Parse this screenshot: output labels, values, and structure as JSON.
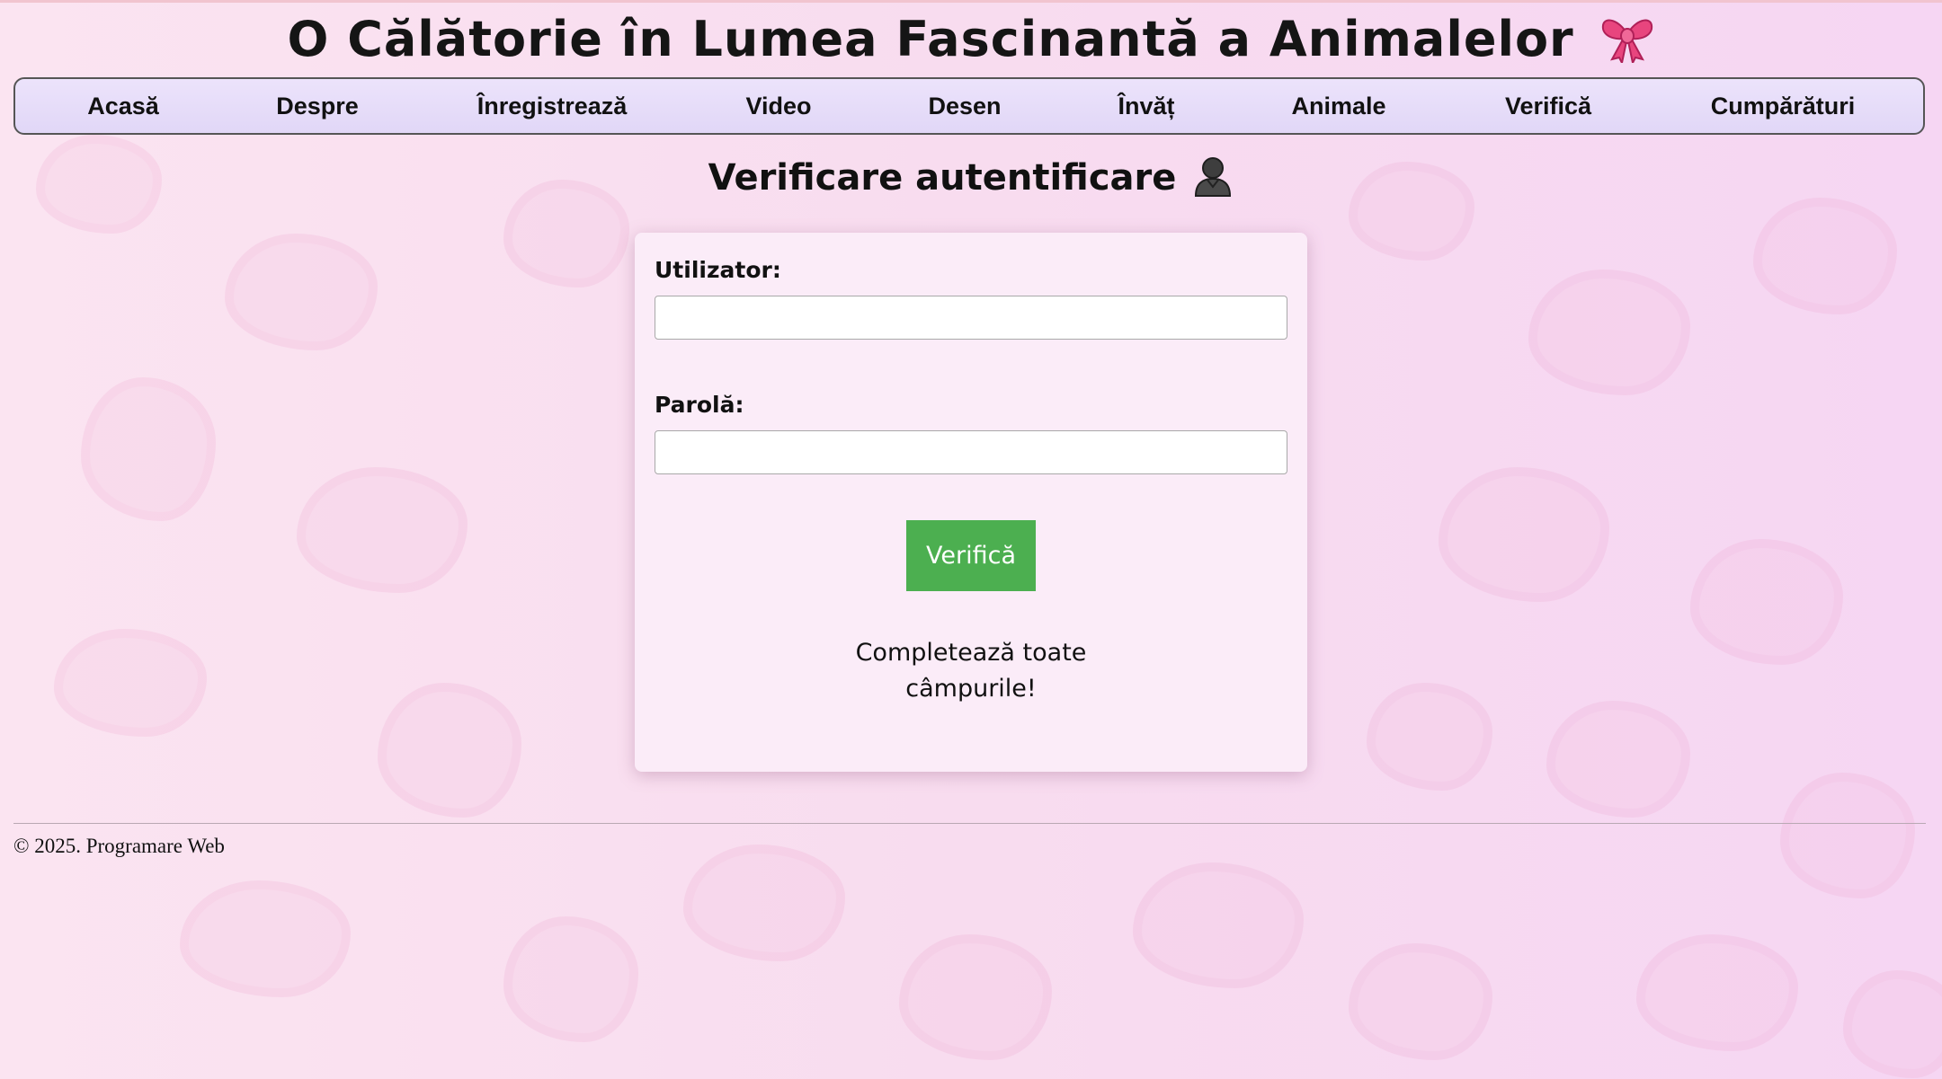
{
  "header": {
    "title": "O Călătorie în Lumea Fascinantă a Animalelor",
    "title_icon": "ribbon-bow-icon"
  },
  "nav": {
    "items": [
      {
        "label": "Acasă"
      },
      {
        "label": "Despre"
      },
      {
        "label": "Înregistrează"
      },
      {
        "label": "Video"
      },
      {
        "label": "Desen"
      },
      {
        "label": "Învăț"
      },
      {
        "label": "Animale"
      },
      {
        "label": "Verifică"
      },
      {
        "label": "Cumpărături"
      }
    ]
  },
  "main": {
    "heading": "Verificare autentificare",
    "heading_icon": "person-silhouette-icon",
    "form": {
      "username_label": "Utilizator:",
      "username_value": "",
      "password_label": "Parolă:",
      "password_value": "",
      "submit_label": "Verifică",
      "status_message": "Completează toate câmpurile!"
    }
  },
  "footer": {
    "text": "© 2025. Programare Web"
  },
  "colors": {
    "nav_background": "#e6ddf9",
    "card_background": "#fbecf8",
    "button_background": "#4caf50",
    "page_background": "#f8dcef"
  }
}
